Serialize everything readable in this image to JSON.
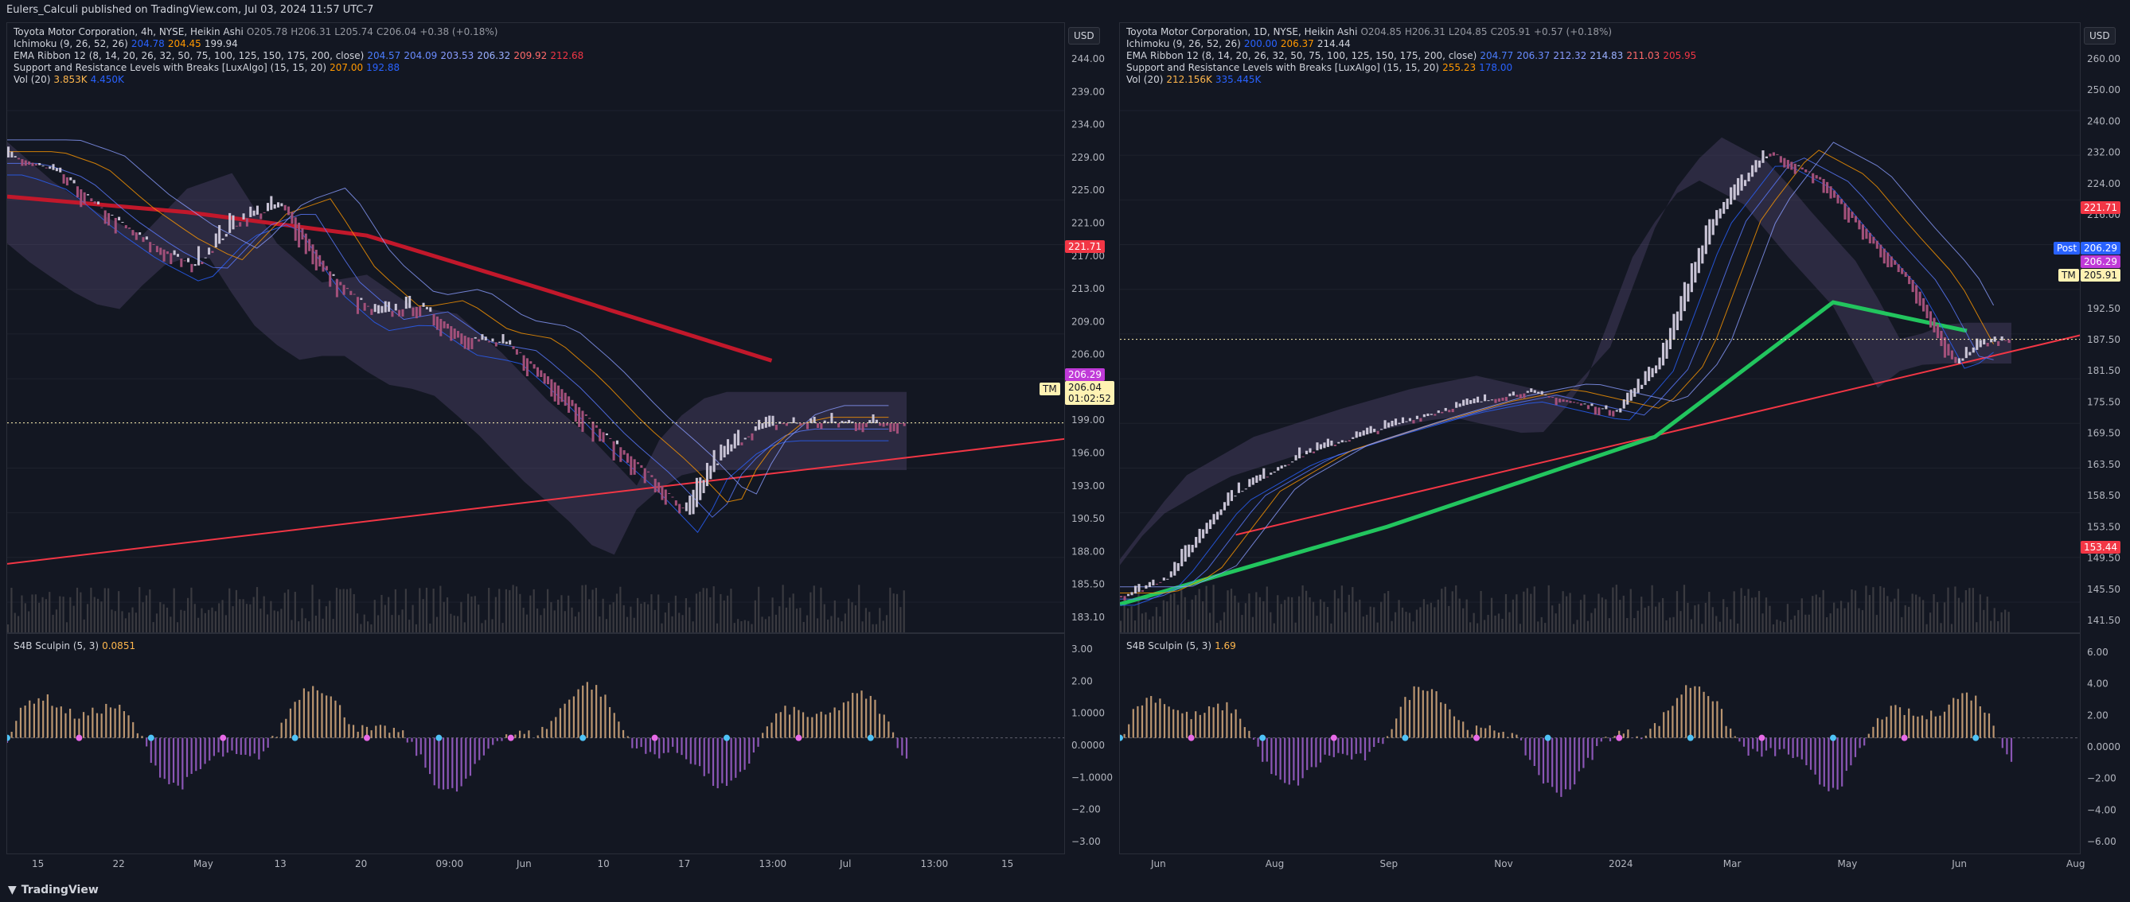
{
  "header": {
    "publish_line": "Eulers_Calculi published on TradingView.com, Jul 03, 2024 11:57 UTC-7"
  },
  "footer": {
    "brand": "TradingView"
  },
  "colors": {
    "bg": "#131722",
    "grid": "#1e222d",
    "up": "#9a8aa8",
    "red": "#f23645",
    "green": "#22c55e",
    "blue": "#2962ff",
    "orange": "#ff9800",
    "cloud": "#5b4d7a"
  },
  "left": {
    "legend": {
      "title": "Toyota Motor Corporation, 4h, NYSE, Heikin Ashi",
      "ohlc": {
        "o": "O205.78",
        "h": "H206.31",
        "l": "L205.74",
        "c": "C206.04",
        "chg": "+0.38 (+0.18%)"
      },
      "ichimoku": {
        "label": "Ichimoku (9, 26, 52, 26)",
        "v1": "204.78",
        "v2": "204.45",
        "v3": "199.94"
      },
      "ema": {
        "label": "EMA Ribbon 12 (8, 14, 20, 26, 32, 50, 75, 100, 125, 150, 175, 200, close)",
        "vals": [
          "204.57",
          "204.09",
          "203.53",
          "206.32",
          "209.92",
          "212.68"
        ]
      },
      "snr": {
        "label": "Support and Resistance Levels with Breaks [LuxAlgo] (15, 15, 20)",
        "v1": "207.00",
        "v2": "192.88"
      },
      "vol": {
        "label": "Vol (20)",
        "v1": "3.853K",
        "v2": "4.450K"
      }
    },
    "currency": "USD",
    "price_ticks": [
      "244.00",
      "239.00",
      "234.00",
      "229.00",
      "225.00",
      "221.00",
      "217.00",
      "213.00",
      "209.00",
      "206.00",
      "202.00",
      "199.00",
      "196.00",
      "193.00",
      "190.50",
      "188.00",
      "185.50",
      "183.10"
    ],
    "badges": {
      "red": "221.71",
      "magenta": "206.29",
      "last": "206.04",
      "countdown": "01:02:52",
      "tm": "TM"
    },
    "osc": {
      "label": "S4B Sculpin (5, 3)",
      "value": "0.0851",
      "ticks": [
        "3.00",
        "2.00",
        "1.0000",
        "0.0000",
        "−1.0000",
        "−2.00",
        "−3.00"
      ]
    },
    "x_ticks": [
      "15",
      "22",
      "May",
      "13",
      "20",
      "09:00",
      "Jun",
      "10",
      "17",
      "13:00",
      "Jul",
      "13:00",
      "15"
    ]
  },
  "right": {
    "legend": {
      "title": "Toyota Motor Corporation, 1D, NYSE, Heikin Ashi",
      "ohlc": {
        "o": "O204.85",
        "h": "H206.31",
        "l": "L204.85",
        "c": "C205.91",
        "chg": "+0.57 (+0.18%)"
      },
      "ichimoku": {
        "label": "Ichimoku (9, 26, 52, 26)",
        "v1": "200.00",
        "v2": "206.37",
        "v3": "214.44"
      },
      "ema": {
        "label": "EMA Ribbon 12 (8, 14, 20, 26, 32, 50, 75, 100, 125, 150, 175, 200, close)",
        "vals": [
          "204.77",
          "206.37",
          "212.32",
          "214.83",
          "211.03",
          "205.95"
        ]
      },
      "snr": {
        "label": "Support and Resistance Levels with Breaks [LuxAlgo] (15, 15, 20)",
        "v1": "255.23",
        "v2": "178.00"
      },
      "vol": {
        "label": "Vol (20)",
        "v1": "212.156K",
        "v2": "335.445K"
      }
    },
    "currency": "USD",
    "price_ticks": [
      "260.00",
      "250.00",
      "240.00",
      "232.00",
      "224.00",
      "216.00",
      "208.00",
      "200.00",
      "192.50",
      "187.50",
      "181.50",
      "175.50",
      "169.50",
      "163.50",
      "158.50",
      "153.50",
      "149.50",
      "145.50",
      "141.50"
    ],
    "badges": {
      "red": "221.71",
      "post_label": "Post",
      "post": "206.29",
      "magenta": "206.29",
      "last": "205.91",
      "tm": "TM",
      "low": "153.44"
    },
    "osc": {
      "label": "S4B Sculpin (5, 3)",
      "value": "1.69",
      "ticks": [
        "6.00",
        "4.00",
        "2.00",
        "0.0000",
        "−2.00",
        "−4.00",
        "−6.00"
      ]
    },
    "x_ticks": [
      "Jun",
      "Aug",
      "Sep",
      "Nov",
      "2024",
      "Mar",
      "May",
      "Jun",
      "Aug"
    ]
  },
  "chart_data": [
    {
      "type": "candlestick",
      "title": "Toyota Motor Corporation, 4h, NYSE, Heikin Ashi",
      "ylim": [
        183.1,
        246
      ],
      "close_path": [
        [
          0,
          240
        ],
        [
          0.05,
          238
        ],
        [
          0.1,
          233
        ],
        [
          0.15,
          229
        ],
        [
          0.2,
          226
        ],
        [
          0.25,
          232
        ],
        [
          0.3,
          234
        ],
        [
          0.35,
          225
        ],
        [
          0.4,
          220
        ],
        [
          0.45,
          221
        ],
        [
          0.5,
          217
        ],
        [
          0.55,
          216
        ],
        [
          0.6,
          211
        ],
        [
          0.65,
          205
        ],
        [
          0.7,
          200
        ],
        [
          0.75,
          194
        ],
        [
          0.78,
          201
        ],
        [
          0.82,
          205
        ],
        [
          0.85,
          206
        ]
      ],
      "ema200": [
        [
          0,
          235
        ],
        [
          0.2,
          233
        ],
        [
          0.4,
          230
        ],
        [
          0.6,
          223
        ],
        [
          0.85,
          214
        ]
      ],
      "trendline": [
        [
          0,
          188
        ],
        [
          1,
          204
        ]
      ],
      "last": 206.04
    },
    {
      "type": "candlestick",
      "title": "Toyota Motor Corporation, 1D, NYSE, Heikin Ashi",
      "ylim": [
        141.5,
        262
      ],
      "close_path": [
        [
          0,
          143
        ],
        [
          0.05,
          148
        ],
        [
          0.12,
          168
        ],
        [
          0.2,
          178
        ],
        [
          0.3,
          185
        ],
        [
          0.38,
          190
        ],
        [
          0.45,
          193
        ],
        [
          0.55,
          188
        ],
        [
          0.6,
          200
        ],
        [
          0.66,
          235
        ],
        [
          0.72,
          252
        ],
        [
          0.78,
          245
        ],
        [
          0.83,
          232
        ],
        [
          0.88,
          220
        ],
        [
          0.93,
          200
        ],
        [
          0.96,
          205
        ],
        [
          0.99,
          206
        ]
      ],
      "ema200": [
        [
          0,
          141
        ],
        [
          0.3,
          160
        ],
        [
          0.6,
          182
        ],
        [
          0.8,
          215
        ],
        [
          0.95,
          208
        ]
      ],
      "trendline": [
        [
          0.13,
          158
        ],
        [
          1,
          207
        ]
      ],
      "last": 205.91
    }
  ]
}
